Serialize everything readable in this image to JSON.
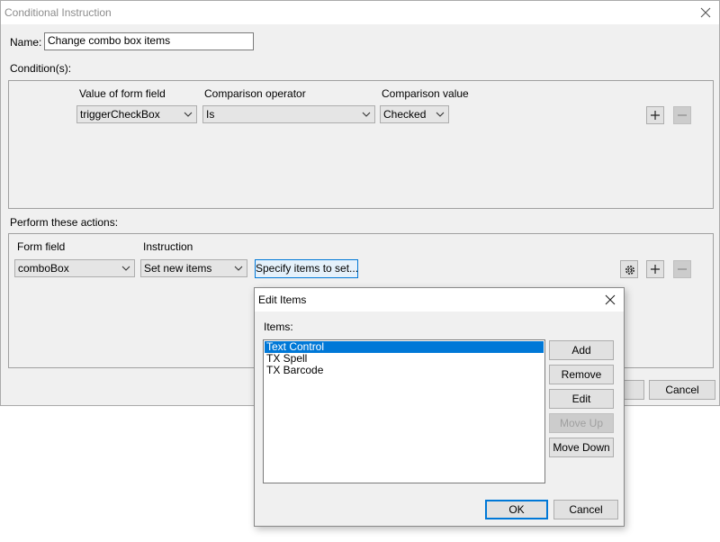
{
  "main_window": {
    "title": "Conditional Instruction",
    "name_label": "Name:",
    "name_value": "Change combo box items",
    "conditions_label": "Condition(s):",
    "condition_headers": {
      "form_field": "Value of form field",
      "operator": "Comparison operator",
      "value": "Comparison value"
    },
    "condition_row": {
      "form_field": "triggerCheckBox",
      "operator": "Is",
      "value": "Checked"
    },
    "actions_label": "Perform these actions:",
    "action_headers": {
      "form_field": "Form field",
      "instruction": "Instruction"
    },
    "action_row": {
      "form_field": "comboBox",
      "instruction": "Set new items",
      "specify_button": "Specify items to set..."
    },
    "cancel_label": "Cancel"
  },
  "edit_dialog": {
    "title": "Edit Items",
    "items_label": "Items:",
    "items": [
      "Text Control",
      "TX Spell",
      "TX Barcode"
    ],
    "selected_index": 0,
    "buttons": {
      "add": "Add",
      "remove": "Remove",
      "edit": "Edit",
      "move_up": "Move Up",
      "move_down": "Move Down",
      "ok": "OK",
      "cancel": "Cancel"
    }
  },
  "icons": {
    "close": "close-icon",
    "dropdown": "chevron-down-icon",
    "add": "plus-icon",
    "remove": "minus-icon",
    "settings": "gear-lightning-icon"
  },
  "colors": {
    "accent": "#0078d7",
    "window_bg": "#f0f0f0",
    "disabled_text": "#a0a0a0"
  }
}
